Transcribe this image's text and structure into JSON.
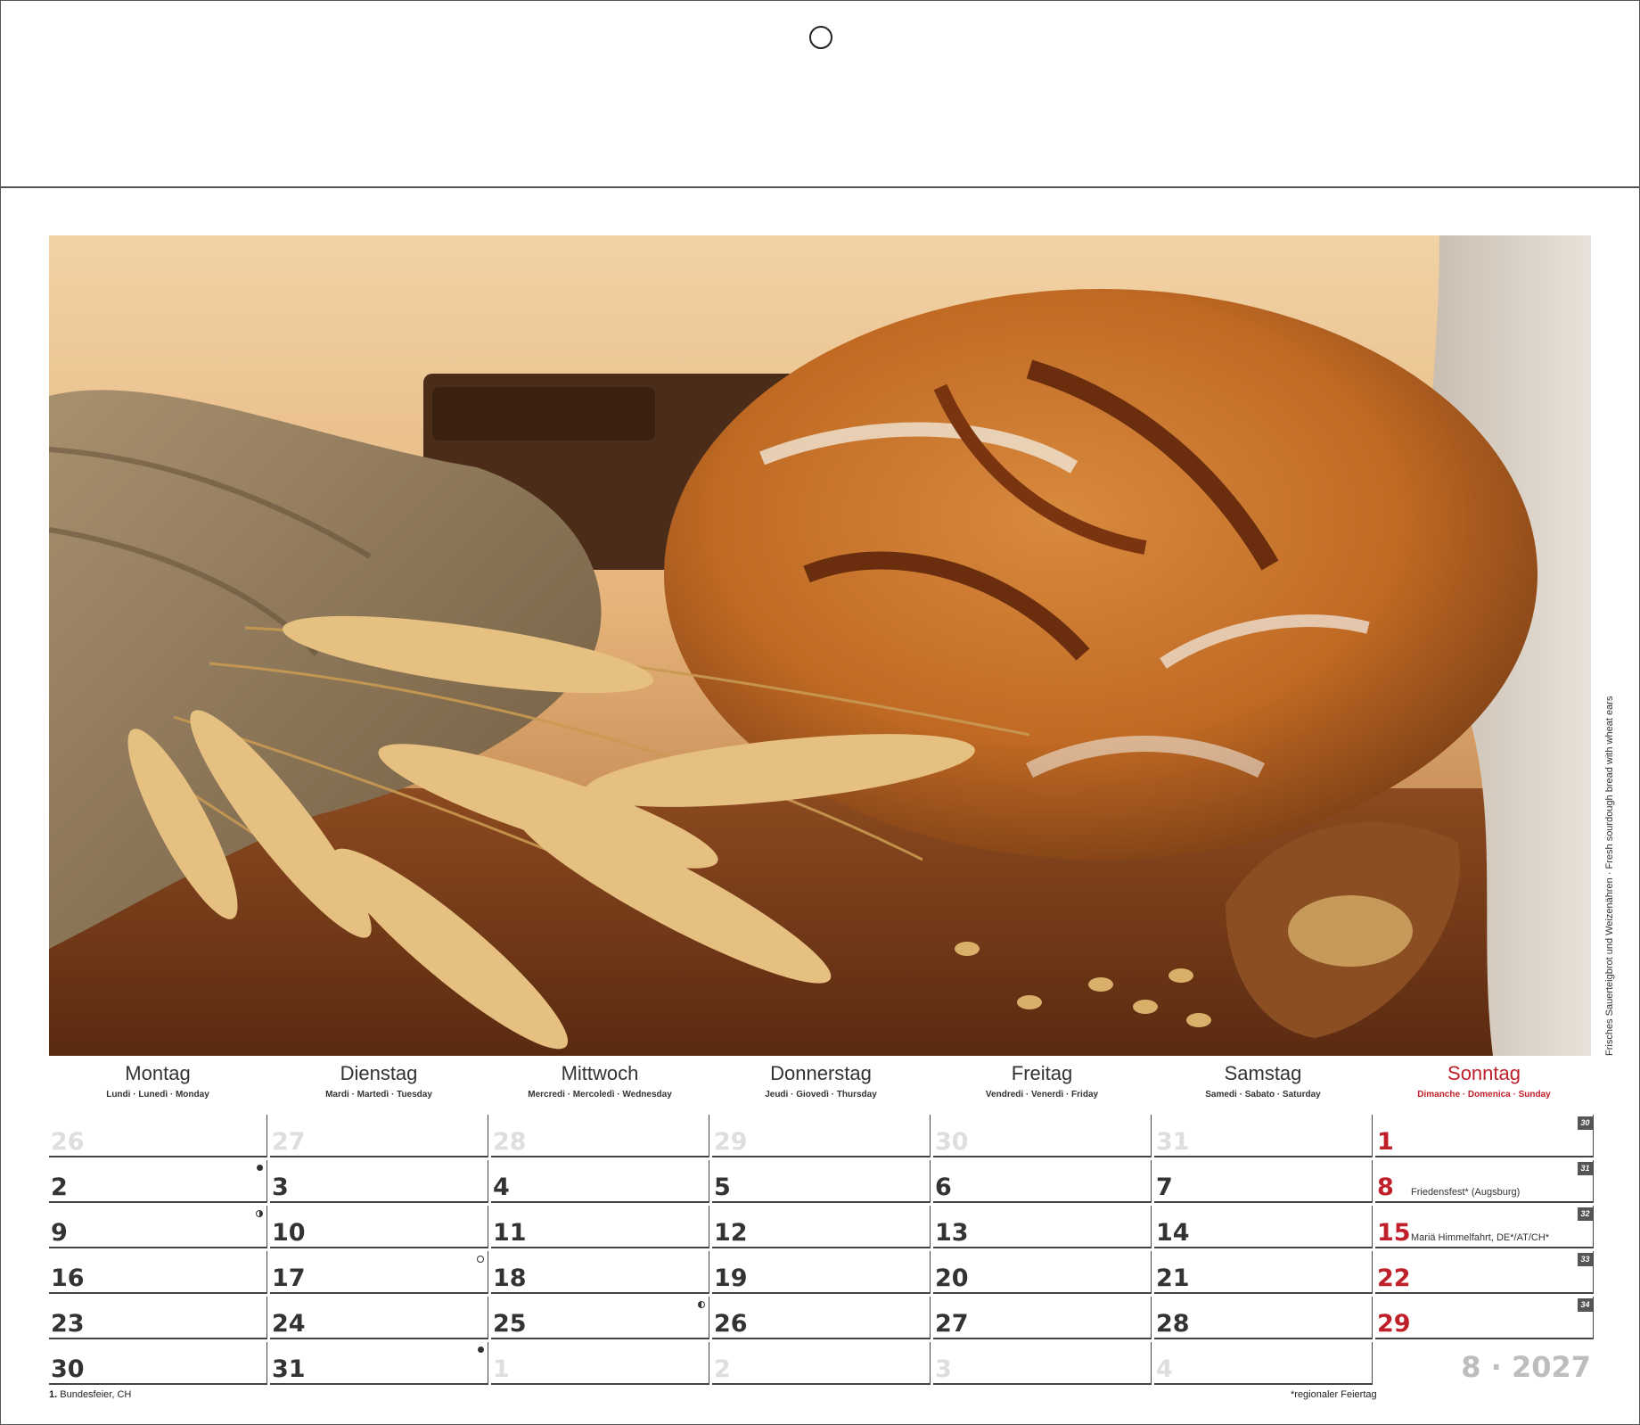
{
  "calendar": {
    "month_year": "8 · 2027",
    "photo_caption": "Frisches Sauerteigbrot und Weizenähren · Fresh sourdough bread with wheat ears",
    "footnote_holiday_date": "1.",
    "footnote_holiday_text": "Bundesfeier, CH",
    "footnote_regional": "*regionaler Feiertag"
  },
  "weekdays": [
    {
      "name": "Montag",
      "sub": "Lundi · Lunedì · Monday"
    },
    {
      "name": "Dienstag",
      "sub": "Mardi · Martedì · Tuesday"
    },
    {
      "name": "Mittwoch",
      "sub": "Mercredi · Mercoledì · Wednesday"
    },
    {
      "name": "Donnerstag",
      "sub": "Jeudi · Giovedì · Thursday"
    },
    {
      "name": "Freitag",
      "sub": "Vendredi · Venerdì · Friday"
    },
    {
      "name": "Samstag",
      "sub": "Samedi · Sabato · Saturday"
    },
    {
      "name": "Sonntag",
      "sub": "Dimanche · Domenica · Sunday"
    }
  ],
  "weeks": [
    {
      "week_no": "30",
      "days": [
        {
          "d": "26",
          "state": "other"
        },
        {
          "d": "27",
          "state": "other"
        },
        {
          "d": "28",
          "state": "other"
        },
        {
          "d": "29",
          "state": "other"
        },
        {
          "d": "30",
          "state": "other"
        },
        {
          "d": "31",
          "state": "other"
        },
        {
          "d": "1",
          "state": "sun"
        }
      ]
    },
    {
      "week_no": "31",
      "days": [
        {
          "d": "2",
          "state": "normal",
          "moon": "new"
        },
        {
          "d": "3",
          "state": "normal"
        },
        {
          "d": "4",
          "state": "normal"
        },
        {
          "d": "5",
          "state": "normal"
        },
        {
          "d": "6",
          "state": "normal"
        },
        {
          "d": "7",
          "state": "normal"
        },
        {
          "d": "8",
          "state": "sun",
          "holiday": "Friedensfest* (Augsburg)"
        }
      ]
    },
    {
      "week_no": "32",
      "days": [
        {
          "d": "9",
          "state": "normal",
          "moon": "half-r"
        },
        {
          "d": "10",
          "state": "normal"
        },
        {
          "d": "11",
          "state": "normal"
        },
        {
          "d": "12",
          "state": "normal"
        },
        {
          "d": "13",
          "state": "normal"
        },
        {
          "d": "14",
          "state": "normal"
        },
        {
          "d": "15",
          "state": "sun",
          "holiday": "Mariä Himmelfahrt, DE*/AT/CH*"
        }
      ]
    },
    {
      "week_no": "33",
      "days": [
        {
          "d": "16",
          "state": "normal"
        },
        {
          "d": "17",
          "state": "normal",
          "moon": "full"
        },
        {
          "d": "18",
          "state": "normal"
        },
        {
          "d": "19",
          "state": "normal"
        },
        {
          "d": "20",
          "state": "normal"
        },
        {
          "d": "21",
          "state": "normal"
        },
        {
          "d": "22",
          "state": "sun"
        }
      ]
    },
    {
      "week_no": "34",
      "days": [
        {
          "d": "23",
          "state": "normal"
        },
        {
          "d": "24",
          "state": "normal"
        },
        {
          "d": "25",
          "state": "normal",
          "moon": "half-l"
        },
        {
          "d": "26",
          "state": "normal"
        },
        {
          "d": "27",
          "state": "normal"
        },
        {
          "d": "28",
          "state": "normal"
        },
        {
          "d": "29",
          "state": "sun"
        }
      ]
    },
    {
      "week_no": "",
      "days": [
        {
          "d": "30",
          "state": "normal"
        },
        {
          "d": "31",
          "state": "normal",
          "moon": "new"
        },
        {
          "d": "1",
          "state": "other"
        },
        {
          "d": "2",
          "state": "other"
        },
        {
          "d": "3",
          "state": "other"
        },
        {
          "d": "4",
          "state": "other"
        },
        {
          "d": "",
          "state": "none"
        }
      ]
    }
  ],
  "colors": {
    "sunday": "#c0202a",
    "text": "#333333",
    "other_month": "#dedede",
    "month_year": "#bdbdbd"
  }
}
